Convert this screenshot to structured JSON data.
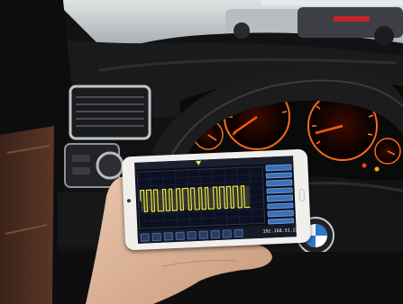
{
  "scene": {
    "description_free": true,
    "dashboard_glow_color": "#ff6a1a",
    "wheel_color": "#1c1c1e"
  },
  "phone_app": {
    "brand_label": "",
    "ip_address": "192.168.51.22",
    "trace_color": "#e8e04a",
    "right_panel_buttons": 8,
    "bottom_icons": [
      "menu-icon",
      "cursor-icon",
      "play-icon",
      "measure-icon",
      "zoom-icon",
      "settings-icon",
      "screenshot-icon",
      "folder-icon",
      "export-icon"
    ]
  }
}
